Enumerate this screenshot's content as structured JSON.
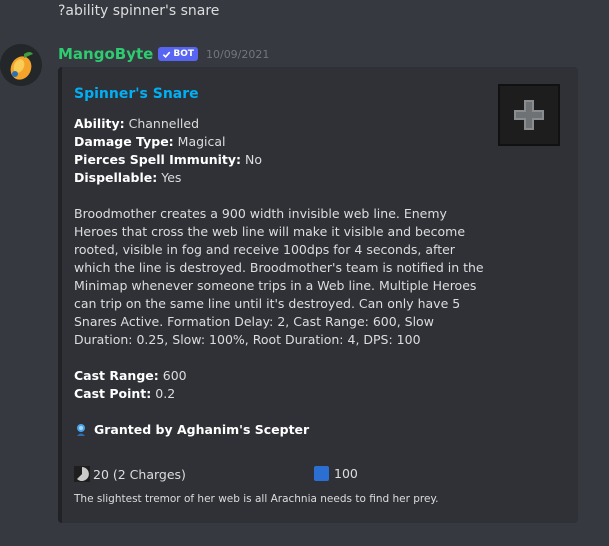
{
  "previous_message": "?ability spinner's snare",
  "message": {
    "username": "MangoByte",
    "bot_tag": "BOT",
    "timestamp": "10/09/2021"
  },
  "embed": {
    "title": "Spinner's Snare",
    "fields": [
      {
        "label": "Ability:",
        "value": "Channelled"
      },
      {
        "label": "Damage Type:",
        "value": "Magical"
      },
      {
        "label": "Pierces Spell Immunity:",
        "value": "No"
      },
      {
        "label": "Dispellable:",
        "value": "Yes"
      }
    ],
    "description": "Broodmother creates a 900 width invisible web line. Enemy Heroes that cross the web line will make it visible and become rooted, visible in fog and receive 100dps for 4 seconds, after which the line is destroyed. Broodmother's team is notified in the Minimap whenever someone trips in a Web line. Multiple Heroes can trip on the same line until it's destroyed. Can only have 5 Snares Active. Formation Delay: 2, Cast Range: 600, Slow Duration: 0.25, Slow: 100%, Root Duration: 4, DPS: 100",
    "stats": [
      {
        "label": "Cast Range:",
        "value": "600"
      },
      {
        "label": "Cast Point:",
        "value": "0.2"
      }
    ],
    "scepter_text": "Granted by Aghanim's Scepter",
    "cooldown_text": "20 (2 Charges)",
    "mana_text": "100",
    "footer_lore": "The slightest tremor of her web is all Arachnia needs to find her prey.",
    "icon": "cross-icon"
  },
  "colors": {
    "username": "#2ecc71",
    "bot_tag": "#5865f2",
    "embed_title": "#00aff4",
    "background": "#36393f",
    "embed_background": "#2f3136"
  }
}
